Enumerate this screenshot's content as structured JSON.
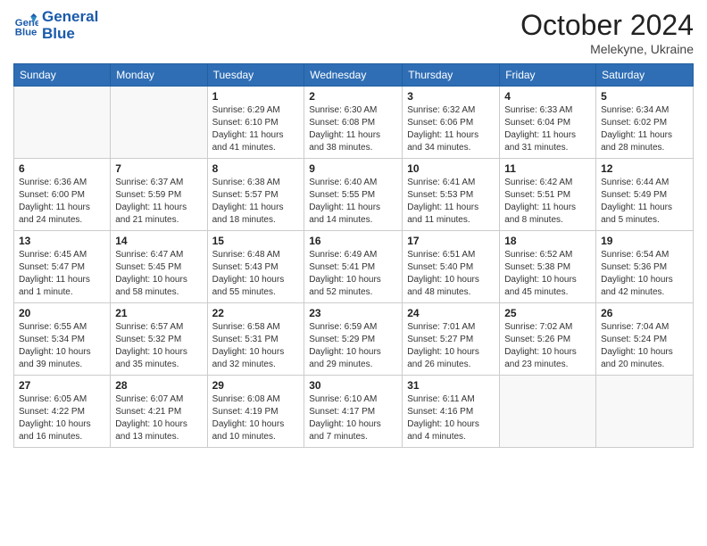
{
  "header": {
    "logo_line1": "General",
    "logo_line2": "Blue",
    "month_title": "October 2024",
    "location": "Melekyne, Ukraine"
  },
  "days_of_week": [
    "Sunday",
    "Monday",
    "Tuesday",
    "Wednesday",
    "Thursday",
    "Friday",
    "Saturday"
  ],
  "weeks": [
    [
      {
        "day": "",
        "info": ""
      },
      {
        "day": "",
        "info": ""
      },
      {
        "day": "1",
        "info": "Sunrise: 6:29 AM\nSunset: 6:10 PM\nDaylight: 11 hours and 41 minutes."
      },
      {
        "day": "2",
        "info": "Sunrise: 6:30 AM\nSunset: 6:08 PM\nDaylight: 11 hours and 38 minutes."
      },
      {
        "day": "3",
        "info": "Sunrise: 6:32 AM\nSunset: 6:06 PM\nDaylight: 11 hours and 34 minutes."
      },
      {
        "day": "4",
        "info": "Sunrise: 6:33 AM\nSunset: 6:04 PM\nDaylight: 11 hours and 31 minutes."
      },
      {
        "day": "5",
        "info": "Sunrise: 6:34 AM\nSunset: 6:02 PM\nDaylight: 11 hours and 28 minutes."
      }
    ],
    [
      {
        "day": "6",
        "info": "Sunrise: 6:36 AM\nSunset: 6:00 PM\nDaylight: 11 hours and 24 minutes."
      },
      {
        "day": "7",
        "info": "Sunrise: 6:37 AM\nSunset: 5:59 PM\nDaylight: 11 hours and 21 minutes."
      },
      {
        "day": "8",
        "info": "Sunrise: 6:38 AM\nSunset: 5:57 PM\nDaylight: 11 hours and 18 minutes."
      },
      {
        "day": "9",
        "info": "Sunrise: 6:40 AM\nSunset: 5:55 PM\nDaylight: 11 hours and 14 minutes."
      },
      {
        "day": "10",
        "info": "Sunrise: 6:41 AM\nSunset: 5:53 PM\nDaylight: 11 hours and 11 minutes."
      },
      {
        "day": "11",
        "info": "Sunrise: 6:42 AM\nSunset: 5:51 PM\nDaylight: 11 hours and 8 minutes."
      },
      {
        "day": "12",
        "info": "Sunrise: 6:44 AM\nSunset: 5:49 PM\nDaylight: 11 hours and 5 minutes."
      }
    ],
    [
      {
        "day": "13",
        "info": "Sunrise: 6:45 AM\nSunset: 5:47 PM\nDaylight: 11 hours and 1 minute."
      },
      {
        "day": "14",
        "info": "Sunrise: 6:47 AM\nSunset: 5:45 PM\nDaylight: 10 hours and 58 minutes."
      },
      {
        "day": "15",
        "info": "Sunrise: 6:48 AM\nSunset: 5:43 PM\nDaylight: 10 hours and 55 minutes."
      },
      {
        "day": "16",
        "info": "Sunrise: 6:49 AM\nSunset: 5:41 PM\nDaylight: 10 hours and 52 minutes."
      },
      {
        "day": "17",
        "info": "Sunrise: 6:51 AM\nSunset: 5:40 PM\nDaylight: 10 hours and 48 minutes."
      },
      {
        "day": "18",
        "info": "Sunrise: 6:52 AM\nSunset: 5:38 PM\nDaylight: 10 hours and 45 minutes."
      },
      {
        "day": "19",
        "info": "Sunrise: 6:54 AM\nSunset: 5:36 PM\nDaylight: 10 hours and 42 minutes."
      }
    ],
    [
      {
        "day": "20",
        "info": "Sunrise: 6:55 AM\nSunset: 5:34 PM\nDaylight: 10 hours and 39 minutes."
      },
      {
        "day": "21",
        "info": "Sunrise: 6:57 AM\nSunset: 5:32 PM\nDaylight: 10 hours and 35 minutes."
      },
      {
        "day": "22",
        "info": "Sunrise: 6:58 AM\nSunset: 5:31 PM\nDaylight: 10 hours and 32 minutes."
      },
      {
        "day": "23",
        "info": "Sunrise: 6:59 AM\nSunset: 5:29 PM\nDaylight: 10 hours and 29 minutes."
      },
      {
        "day": "24",
        "info": "Sunrise: 7:01 AM\nSunset: 5:27 PM\nDaylight: 10 hours and 26 minutes."
      },
      {
        "day": "25",
        "info": "Sunrise: 7:02 AM\nSunset: 5:26 PM\nDaylight: 10 hours and 23 minutes."
      },
      {
        "day": "26",
        "info": "Sunrise: 7:04 AM\nSunset: 5:24 PM\nDaylight: 10 hours and 20 minutes."
      }
    ],
    [
      {
        "day": "27",
        "info": "Sunrise: 6:05 AM\nSunset: 4:22 PM\nDaylight: 10 hours and 16 minutes."
      },
      {
        "day": "28",
        "info": "Sunrise: 6:07 AM\nSunset: 4:21 PM\nDaylight: 10 hours and 13 minutes."
      },
      {
        "day": "29",
        "info": "Sunrise: 6:08 AM\nSunset: 4:19 PM\nDaylight: 10 hours and 10 minutes."
      },
      {
        "day": "30",
        "info": "Sunrise: 6:10 AM\nSunset: 4:17 PM\nDaylight: 10 hours and 7 minutes."
      },
      {
        "day": "31",
        "info": "Sunrise: 6:11 AM\nSunset: 4:16 PM\nDaylight: 10 hours and 4 minutes."
      },
      {
        "day": "",
        "info": ""
      },
      {
        "day": "",
        "info": ""
      }
    ]
  ]
}
